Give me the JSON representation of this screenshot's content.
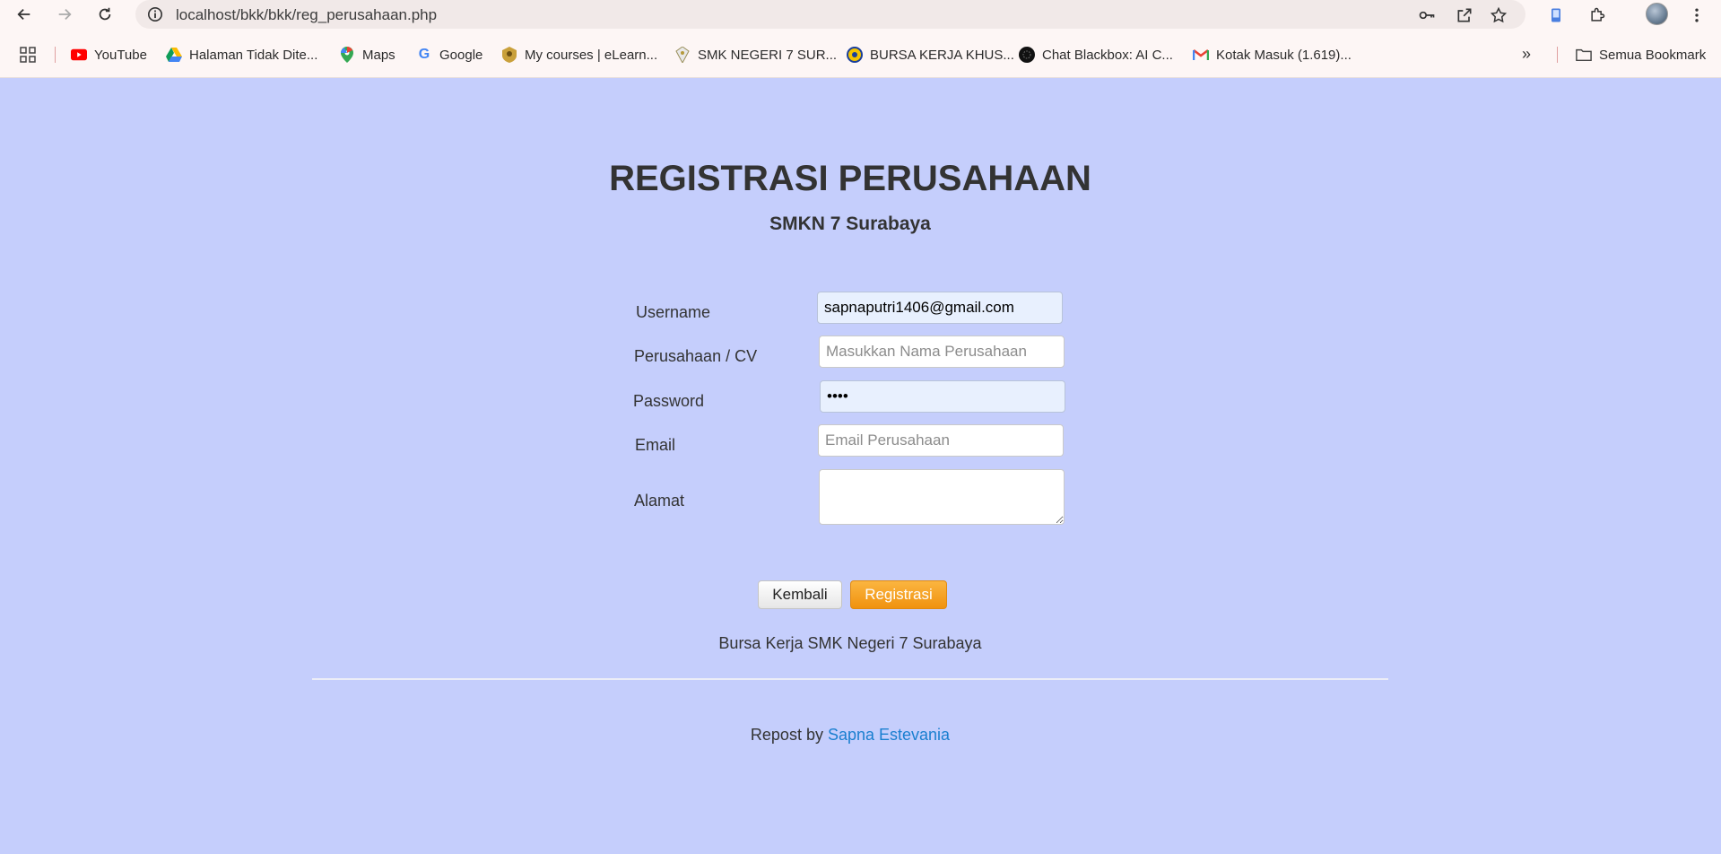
{
  "browser": {
    "url": "localhost/bkk/bkk/reg_perusahaan.php",
    "bookmarks": [
      {
        "label": "YouTube",
        "icon": "youtube-icon"
      },
      {
        "label": "Halaman Tidak Dite...",
        "icon": "google-drive-icon"
      },
      {
        "label": "Maps",
        "icon": "maps-icon"
      },
      {
        "label": "Google",
        "icon": "google-icon"
      },
      {
        "label": "My courses | eLearn...",
        "icon": "elearning-icon"
      },
      {
        "label": "SMK NEGERI 7 SUR...",
        "icon": "school-icon"
      },
      {
        "label": "BURSA KERJA KHUS...",
        "icon": "bkk-icon"
      },
      {
        "label": "Chat Blackbox: AI C...",
        "icon": "blackbox-icon"
      },
      {
        "label": "Kotak Masuk (1.619)...",
        "icon": "gmail-icon"
      }
    ],
    "all_bookmarks_label": "Semua Bookmark"
  },
  "page": {
    "title": "REGISTRASI PERUSAHAAN",
    "subtitle": "SMKN 7 Surabaya"
  },
  "form": {
    "username": {
      "label": "Username",
      "value": "sapnaputri1406@gmail.com",
      "placeholder": ""
    },
    "company": {
      "label": "Perusahaan / CV",
      "value": "",
      "placeholder": "Masukkan Nama Perusahaan"
    },
    "password": {
      "label": "Password",
      "value": "••••",
      "placeholder": ""
    },
    "email": {
      "label": "Email",
      "value": "",
      "placeholder": "Email Perusahaan"
    },
    "address": {
      "label": "Alamat",
      "value": "",
      "placeholder": ""
    }
  },
  "buttons": {
    "back": "Kembali",
    "register": "Registrasi"
  },
  "footer": {
    "text": "Bursa Kerja SMK Negeri 7 Surabaya",
    "repost_prefix": "Repost by",
    "repost_author": "Sapna Estevania"
  },
  "colors": {
    "page_background": "#c5cefc",
    "register_button": "#f7a52a",
    "link": "#1a7fd0"
  }
}
